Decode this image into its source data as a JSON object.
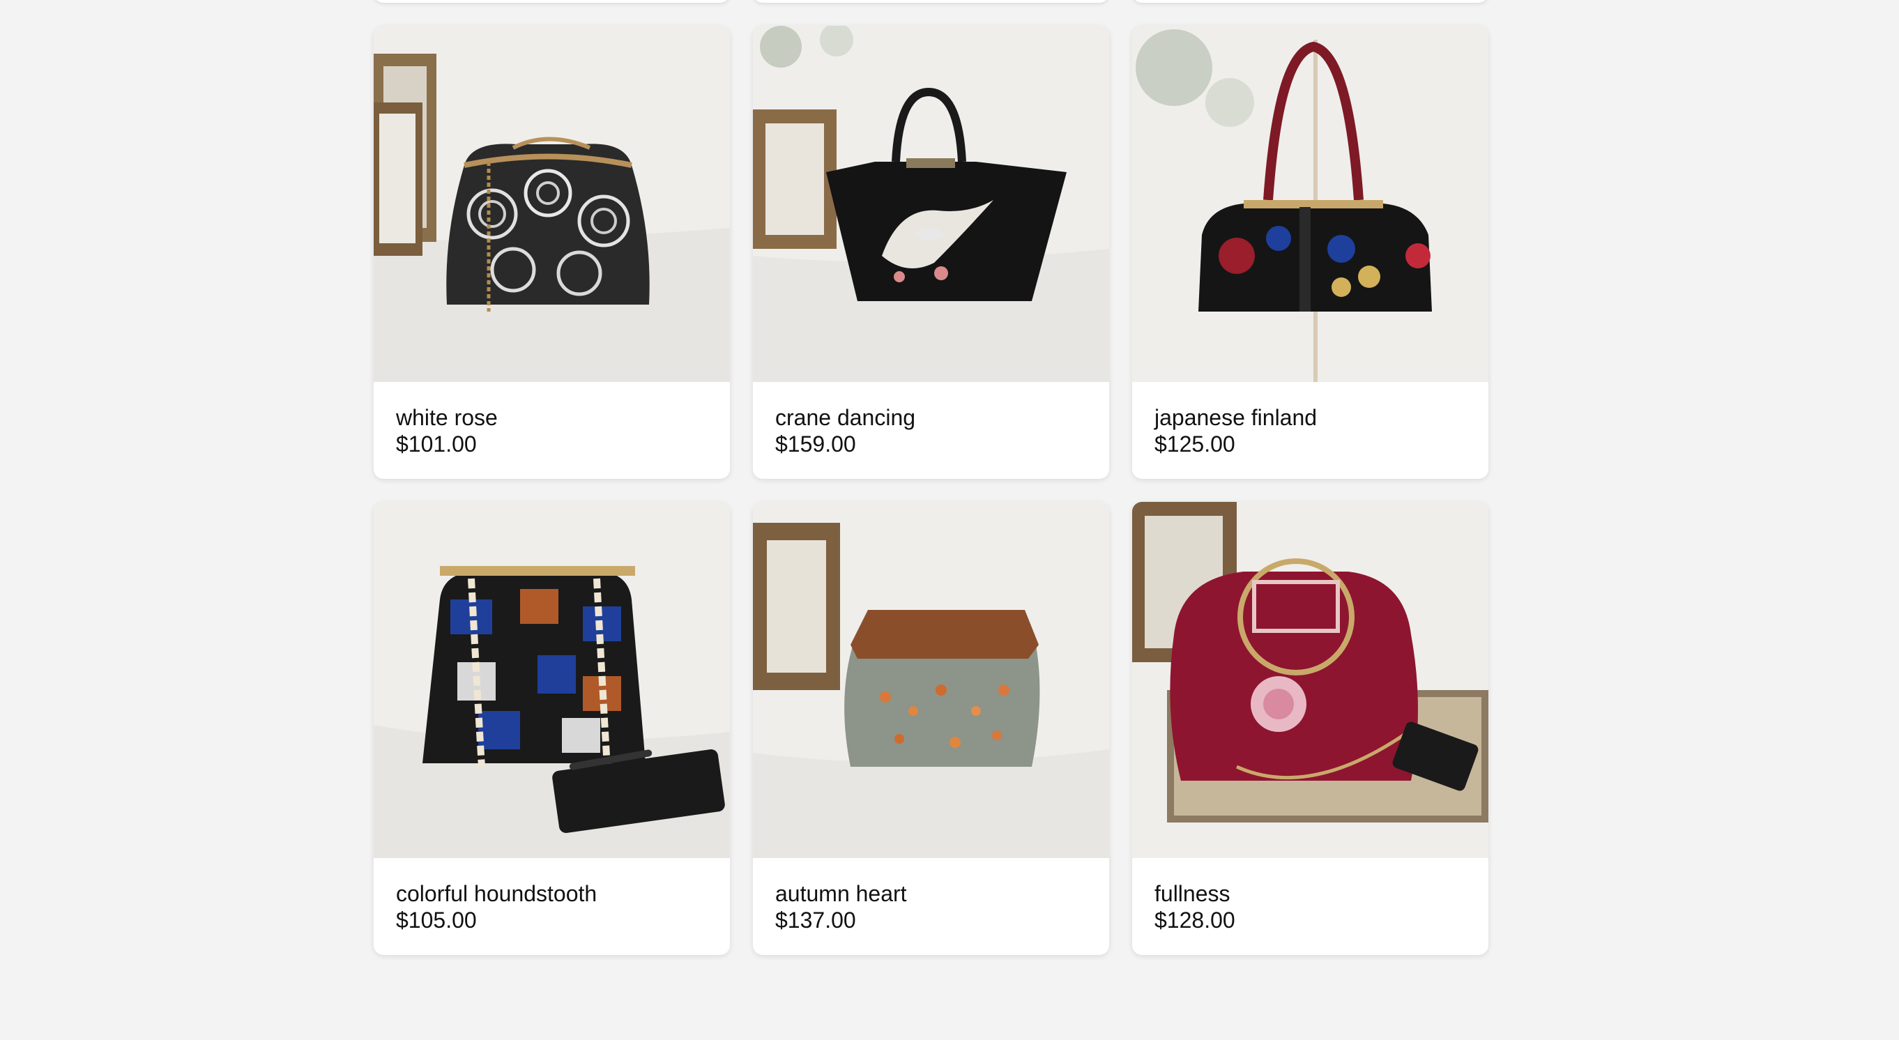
{
  "products": [
    {
      "name": "white rose",
      "price": "$101.00",
      "image_alt": "white rose handbag",
      "accent": "#444444"
    },
    {
      "name": "crane dancing",
      "price": "$159.00",
      "image_alt": "crane dancing handbag",
      "accent": "#1b1b1b"
    },
    {
      "name": "japanese finland",
      "price": "$125.00",
      "image_alt": "japanese finland handbag",
      "accent": "#8a1f2a"
    },
    {
      "name": "colorful houndstooth",
      "price": "$105.00",
      "image_alt": "colorful houndstooth handbag",
      "accent": "#1f3f9a"
    },
    {
      "name": "autumn heart",
      "price": "$137.00",
      "image_alt": "autumn heart handbag",
      "accent": "#9a5a2b"
    },
    {
      "name": "fullness",
      "price": "$128.00",
      "image_alt": "fullness handbag",
      "accent": "#8e1530"
    }
  ],
  "colors": {
    "page_background": "#f3f3f3",
    "card_background": "#ffffff",
    "text": "#111111"
  }
}
